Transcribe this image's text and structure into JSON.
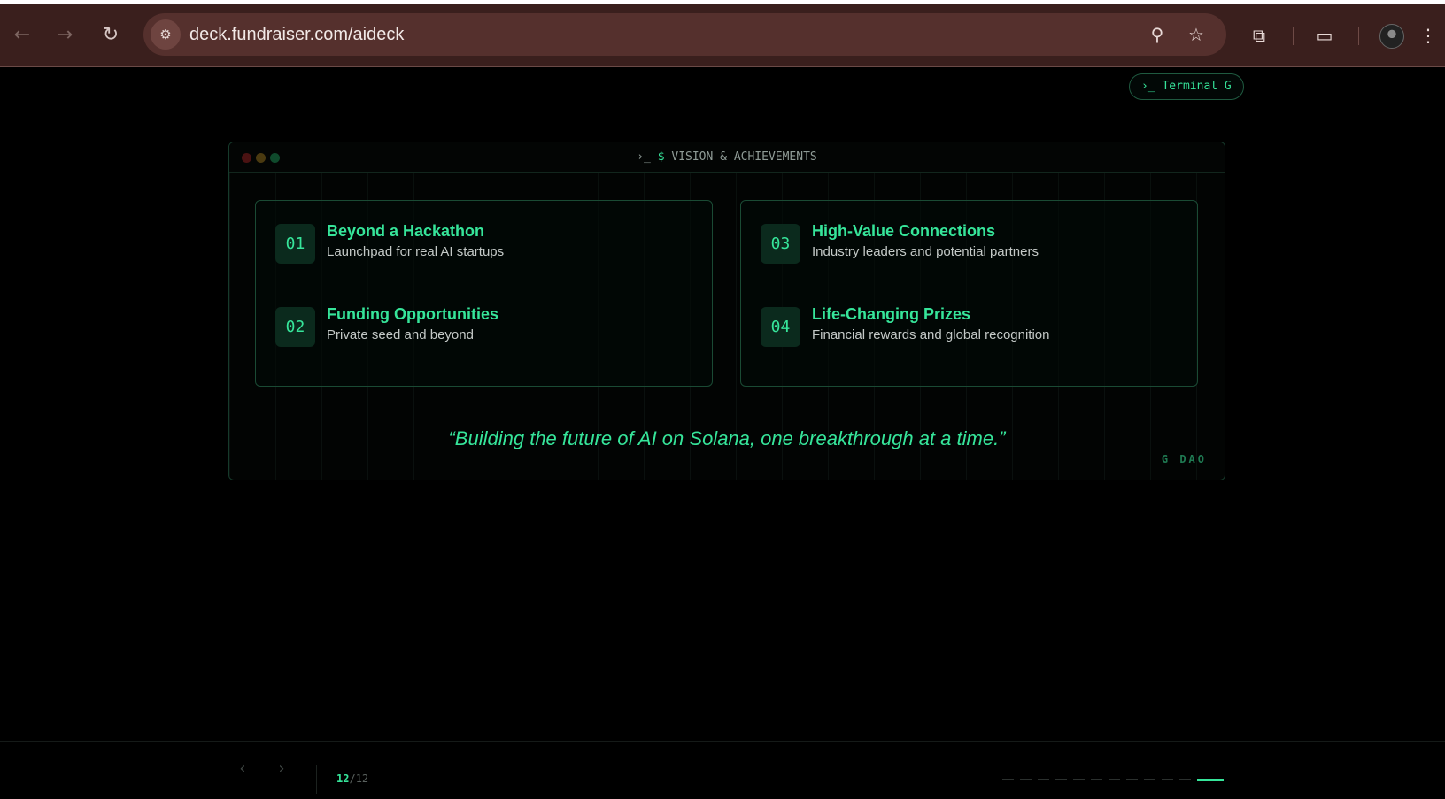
{
  "browser": {
    "url": "deck.fundraiser.com/aideck",
    "icons": [
      "back-icon",
      "forward-icon",
      "reload-icon",
      "site-info-icon",
      "zoom-icon",
      "bookmark-star-icon",
      "extensions-icon",
      "tab-search-icon",
      "profile-avatar",
      "menu-icon"
    ]
  },
  "topbar": {
    "terminal_label": "Terminal G"
  },
  "slide": {
    "window_title": "VISION & ACHIEVEMENTS",
    "prompt_prefix": "›_",
    "prompt_dollar": "$",
    "items": [
      {
        "num": "01",
        "title": "Beyond a Hackathon",
        "subtitle": "Launchpad for real AI startups"
      },
      {
        "num": "02",
        "title": "Funding Opportunities",
        "subtitle": "Private seed and beyond"
      },
      {
        "num": "03",
        "title": "High-Value Connections",
        "subtitle": "Industry leaders and potential partners"
      },
      {
        "num": "04",
        "title": "Life-Changing Prizes",
        "subtitle": "Financial rewards and global recognition"
      }
    ],
    "quote": "“Building the future of AI on Solana, one breakthrough at a time.”",
    "brand": "G DAO"
  },
  "footer": {
    "current_slide": "12",
    "separator": "/",
    "total_slides": "12",
    "accent_color": "#36e59a"
  }
}
